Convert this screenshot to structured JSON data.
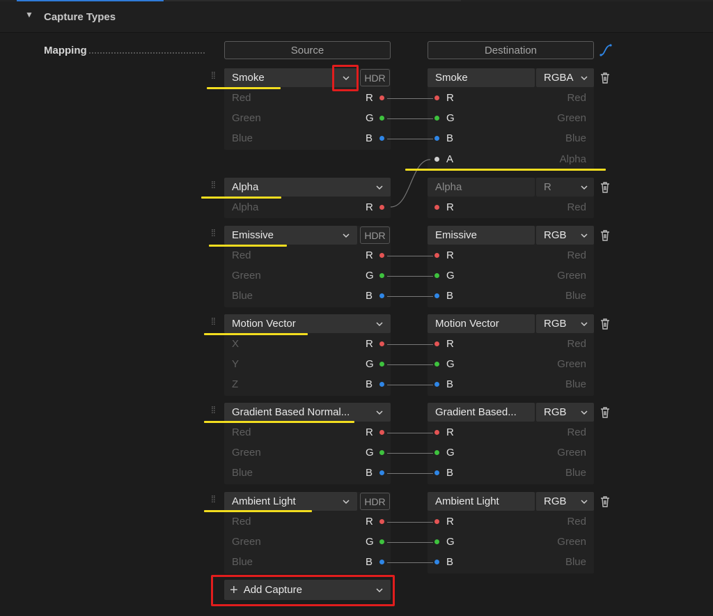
{
  "section": {
    "title": "Capture Types",
    "mapping_label": "Mapping"
  },
  "headers": {
    "source": "Source",
    "destination": "Destination"
  },
  "hdr_label": "HDR",
  "add_capture_label": "Add Capture",
  "captures": [
    {
      "source": "Smoke",
      "hdr": true,
      "source_channels": [
        {
          "name": "Red",
          "letter": "R",
          "color": "#e45454"
        },
        {
          "name": "Green",
          "letter": "G",
          "color": "#3ec23e"
        },
        {
          "name": "Blue",
          "letter": "B",
          "color": "#2f86e6"
        }
      ],
      "dest": "Smoke",
      "format": "RGBA",
      "dest_channels": [
        {
          "letter": "R",
          "name": "Red",
          "color": "#e45454"
        },
        {
          "letter": "G",
          "name": "Green",
          "color": "#3ec23e"
        },
        {
          "letter": "B",
          "name": "Blue",
          "color": "#2f86e6"
        },
        {
          "letter": "A",
          "name": "Alpha",
          "color": "#d0d0d0"
        }
      ]
    },
    {
      "source": "Alpha",
      "hdr": false,
      "source_channels": [
        {
          "name": "Alpha",
          "letter": "R",
          "color": "#e45454"
        }
      ],
      "dest": "Alpha",
      "format": "R",
      "dest_channels": [
        {
          "letter": "R",
          "name": "Red",
          "color": "#e45454"
        }
      ]
    },
    {
      "source": "Emissive",
      "hdr": true,
      "source_channels": [
        {
          "name": "Red",
          "letter": "R",
          "color": "#e45454"
        },
        {
          "name": "Green",
          "letter": "G",
          "color": "#3ec23e"
        },
        {
          "name": "Blue",
          "letter": "B",
          "color": "#2f86e6"
        }
      ],
      "dest": "Emissive",
      "format": "RGB",
      "dest_channels": [
        {
          "letter": "R",
          "name": "Red",
          "color": "#e45454"
        },
        {
          "letter": "G",
          "name": "Green",
          "color": "#3ec23e"
        },
        {
          "letter": "B",
          "name": "Blue",
          "color": "#2f86e6"
        }
      ]
    },
    {
      "source": "Motion Vector",
      "hdr": false,
      "source_channels": [
        {
          "name": "X",
          "letter": "R",
          "color": "#e45454"
        },
        {
          "name": "Y",
          "letter": "G",
          "color": "#3ec23e"
        },
        {
          "name": "Z",
          "letter": "B",
          "color": "#2f86e6"
        }
      ],
      "dest": "Motion Vector",
      "format": "RGB",
      "dest_channels": [
        {
          "letter": "R",
          "name": "Red",
          "color": "#e45454"
        },
        {
          "letter": "G",
          "name": "Green",
          "color": "#3ec23e"
        },
        {
          "letter": "B",
          "name": "Blue",
          "color": "#2f86e6"
        }
      ]
    },
    {
      "source": "Gradient Based Normal...",
      "hdr": false,
      "source_channels": [
        {
          "name": "Red",
          "letter": "R",
          "color": "#e45454"
        },
        {
          "name": "Green",
          "letter": "G",
          "color": "#3ec23e"
        },
        {
          "name": "Blue",
          "letter": "B",
          "color": "#2f86e6"
        }
      ],
      "dest": "Gradient Based...",
      "format": "RGB",
      "dest_channels": [
        {
          "letter": "R",
          "name": "Red",
          "color": "#e45454"
        },
        {
          "letter": "G",
          "name": "Green",
          "color": "#3ec23e"
        },
        {
          "letter": "B",
          "name": "Blue",
          "color": "#2f86e6"
        }
      ]
    },
    {
      "source": "Ambient Light",
      "hdr": true,
      "source_channels": [
        {
          "name": "Red",
          "letter": "R",
          "color": "#e45454"
        },
        {
          "name": "Green",
          "letter": "G",
          "color": "#3ec23e"
        },
        {
          "name": "Blue",
          "letter": "B",
          "color": "#2f86e6"
        }
      ],
      "dest": "Ambient Light",
      "format": "RGB",
      "dest_channels": [
        {
          "letter": "R",
          "name": "Red",
          "color": "#e45454"
        },
        {
          "letter": "G",
          "name": "Green",
          "color": "#3ec23e"
        },
        {
          "letter": "B",
          "name": "Blue",
          "color": "#2f86e6"
        }
      ]
    }
  ],
  "icons": {
    "section_toggle": "triangle-down-icon",
    "curve": "curve-icon",
    "grip": "drag-handle-icon",
    "chevron": "chevron-down-icon",
    "delete": "trash-icon",
    "add": "plus-icon"
  },
  "colors": {
    "accent": "#2f7bd8",
    "highlight_underline": "#f2dd1f",
    "highlight_box": "#e11d1d"
  }
}
